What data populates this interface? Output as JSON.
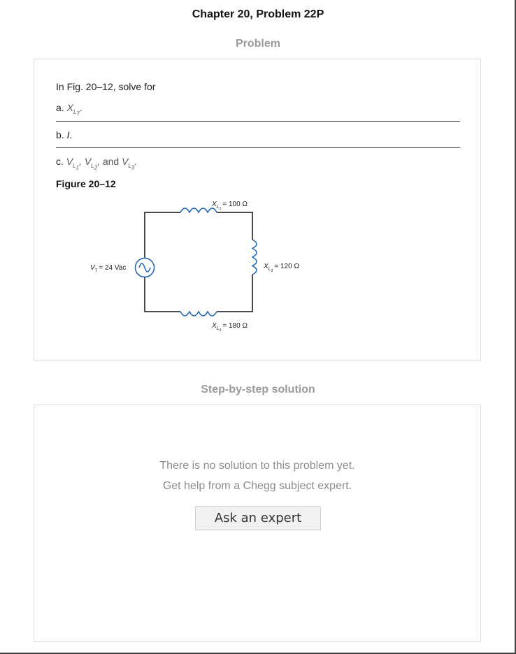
{
  "header": {
    "title": "Chapter 20, Problem 22P"
  },
  "problem": {
    "heading": "Problem",
    "intro": "In Fig. 20–12, solve for",
    "item_a": {
      "prefix": "a.",
      "var": "X",
      "sub": "L",
      "subsub": "T",
      "suffix": "."
    },
    "item_b": {
      "prefix": "b.",
      "var": "I",
      "suffix": "."
    },
    "item_c": {
      "prefix": "c.",
      "v1": "V",
      "v1_sub": "L",
      "v1_subsub": "1",
      "v2": "V",
      "v2_sub": "L",
      "v2_subsub": "2",
      "and": "and",
      "v3": "V",
      "v3_sub": "L",
      "v3_subsub": "3",
      "suffix": "."
    },
    "figure_label": "Figure 20–12",
    "figure": {
      "top_inductor": "= 100 Ω",
      "right_inductor": "= 120 Ω",
      "bottom_inductor": "= 180 Ω",
      "source": "= 24 Vac",
      "source_var": "V",
      "source_sub": "T",
      "x_var": "X",
      "l_sub": "L",
      "n1": "1",
      "n2": "2",
      "n3": "3",
      "wire_color": "#111111",
      "component_color": "#1a63b8"
    }
  },
  "solution": {
    "heading": "Step-by-step solution",
    "line1": "There is no solution to this problem yet.",
    "line2": "Get help from a Chegg subject expert.",
    "ask_button": "Ask an expert"
  }
}
